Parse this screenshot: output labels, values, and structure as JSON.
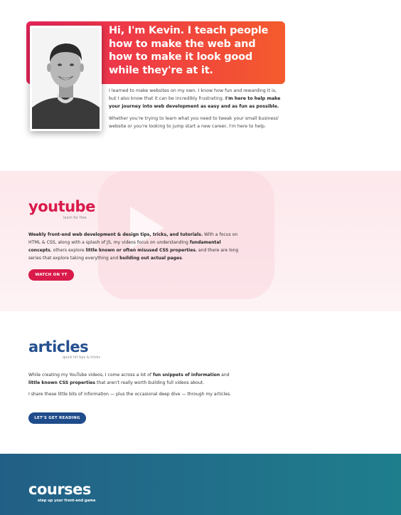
{
  "hero": {
    "title": "Hi, I'm Kevin. I teach people how to make the web and how to make it look good while they're at it.",
    "p1_a": "I learned to make websites on my own. I know how fun and rewarding it is, but I also know that it can be incredibly frustrating. ",
    "p1_b": "I'm here to help make your journey into web development as easy and as fun as possible.",
    "p2": "Whether you're trying to learn what you need to tweak your small business' website or you're looking to jump start a new career, I'm here to help."
  },
  "youtube": {
    "title": "youtube",
    "subtitle": "learn for free",
    "t1": "Weekly front-end web development & design tips, tricks, and tutorials.",
    "t2": " With a focus on HTML & CSS, along with a splash of JS, my videos focus on understanding ",
    "t3": "fundamental concepts",
    "t4": ", others explore ",
    "t5": "little known or often misused CSS properties",
    "t6": ", and there are long series that explore taking everything and ",
    "t7": "building out actual pages",
    "t8": ".",
    "button": "WATCH ON YT"
  },
  "articles": {
    "title": "articles",
    "subtitle": "quick hit tips & tricks",
    "t1": "While creating my YouTube videos, I come across a lot of ",
    "t2": "fun snippets of information",
    "t3": " and ",
    "t4": "little known CSS properties",
    "t5": " that aren't really worth building full videos about.",
    "p2": "I share these little bits of information — plus the occasional deep dive — through my articles.",
    "button": "LET'S GET READING"
  },
  "courses": {
    "title": "courses",
    "subtitle": "step up your front-end game"
  },
  "colors": {
    "hero_gradient_start": "#e8245b",
    "hero_gradient_end": "#f45b2d",
    "youtube_accent": "#d81b4b",
    "articles_accent": "#25508f",
    "courses_bg": "#21708a"
  }
}
